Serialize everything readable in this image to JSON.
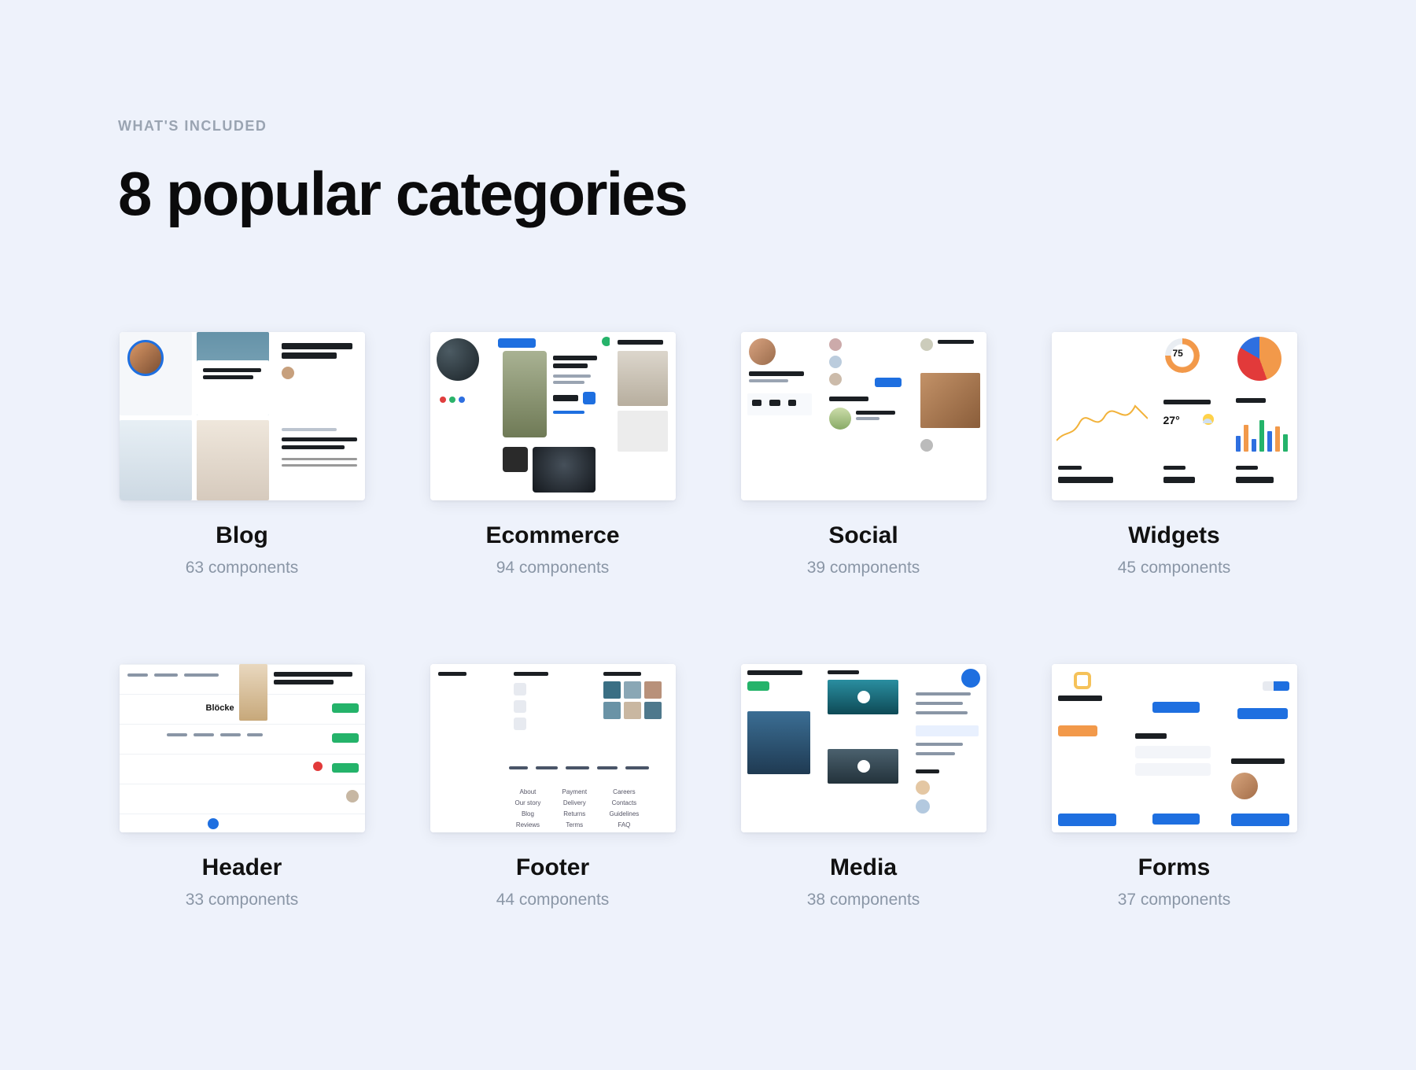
{
  "eyebrow": "WHAT'S INCLUDED",
  "title": "8 popular categories",
  "categories": [
    {
      "name": "Blog",
      "count": 63,
      "subtitle": "63 components"
    },
    {
      "name": "Ecommerce",
      "count": 94,
      "subtitle": "94 components"
    },
    {
      "name": "Social",
      "count": 39,
      "subtitle": "39 components"
    },
    {
      "name": "Widgets",
      "count": 45,
      "subtitle": "45 components"
    },
    {
      "name": "Header",
      "count": 33,
      "subtitle": "33 components"
    },
    {
      "name": "Footer",
      "count": 44,
      "subtitle": "44 components"
    },
    {
      "name": "Media",
      "count": 38,
      "subtitle": "38 components"
    },
    {
      "name": "Forms",
      "count": 37,
      "subtitle": "37 components"
    }
  ],
  "thumb_labels": {
    "widgets_percent": "75",
    "widgets_temp": "27°",
    "header_brand": "Blöcke"
  },
  "colors": {
    "bg": "#eef2fb",
    "text_primary": "#0b0b0c",
    "text_muted": "#8a96a6",
    "accent_blue": "#1e6fe0",
    "accent_green": "#24b36a",
    "accent_orange": "#f2994a",
    "accent_red": "#e23a3a"
  }
}
